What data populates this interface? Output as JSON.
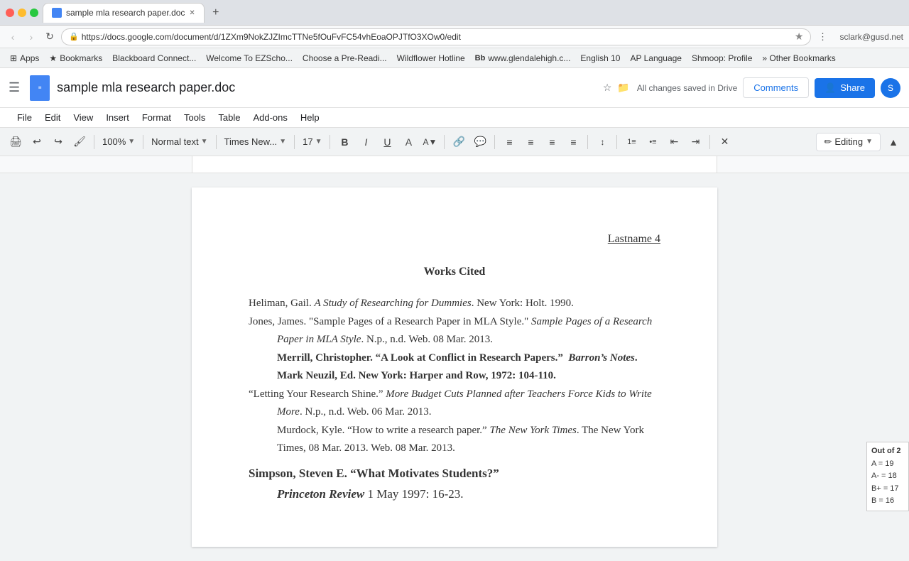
{
  "browser": {
    "tab_title": "sample mla research paper.doc",
    "url": "https://docs.google.com/document/d/1ZXm9NokZJZImcTTNe5fOuFvFC54vhEoaOPJTfO3XOw0/edit",
    "user_email": "sclark@gusd.net"
  },
  "bookmarks": [
    {
      "label": "Apps",
      "icon": "⊞"
    },
    {
      "label": "Bookmarks",
      "icon": "★"
    },
    {
      "label": "Blackboard Connect...",
      "icon": "📋"
    },
    {
      "label": "Welcome To EZScho...",
      "icon": "📄"
    },
    {
      "label": "Choose a Pre-Readi...",
      "icon": "🔖"
    },
    {
      "label": "Wildflower Hotline",
      "icon": "🌸"
    },
    {
      "label": "www.glendalehigh.c...",
      "icon": "Bb"
    },
    {
      "label": "English 10",
      "icon": "📚"
    },
    {
      "label": "AP Language",
      "icon": "📚"
    },
    {
      "label": "Shmoop: Profile",
      "icon": "📘"
    },
    {
      "label": "Other Bookmarks",
      "icon": "»"
    }
  ],
  "docs": {
    "title": "sample mla research paper.doc",
    "autosave": "All changes saved in Drive",
    "menu_items": [
      "File",
      "Edit",
      "View",
      "Insert",
      "Format",
      "Tools",
      "Table",
      "Add-ons",
      "Help"
    ],
    "toolbar": {
      "zoom": "100%",
      "style": "Normal text",
      "font": "Times New...",
      "size": "17",
      "editing_mode": "Editing"
    },
    "share_label": "Share",
    "comments_label": "Comments"
  },
  "document": {
    "page_number": "Lastname 4",
    "section_title": "Works Cited",
    "citations": [
      {
        "id": "citation-1",
        "text": "Heliman, Gail. ",
        "italic_part": "A Study of Researching for Dummies",
        "rest": ". New York: Holt. 1990.",
        "indent": false
      },
      {
        "id": "citation-2",
        "text_before": "Jones, James. \"Sample Pages of a Research Paper in MLA Style.\" ",
        "italic_part": "Sample Pages of a Research Paper in MLA Style",
        "rest": ". N.p., n.d. Web. 08 Mar. 2013.",
        "indent": false
      },
      {
        "id": "citation-3",
        "text_before": "Merrill, Christopher. “A Look at Conflict in Research Papers.”  ",
        "italic_part": "Barron’s Notes",
        "rest": ". Mark Neuzil, Ed. New York: Harper and Row, 1972: 104-110.",
        "indent": true
      },
      {
        "id": "citation-4",
        "text_before": "“Letting Your Research Shine.” ",
        "italic_part": "More Budget Cuts Planned after Teachers Force Kids to Write More",
        "rest": ". N.p., n.d. Web. 06 Mar. 2013.",
        "indent": false
      },
      {
        "id": "citation-5",
        "text_before": "Murdock, Kyle. “How to write a research paper.” ",
        "italic_part": "The New York Times",
        "rest": ". The New York Times, 08 Mar. 2013. Web. 08 Mar. 2013.",
        "indent": true
      },
      {
        "id": "citation-6",
        "bold_part": "Simpson, Steven E. “What Motivates Students?”",
        "rest": "",
        "indent": false,
        "is_bold": true
      },
      {
        "id": "citation-7",
        "italic_part": "Princeton Review",
        "rest": " 1 May 1997: 16-23.",
        "indent": true,
        "is_bold_italic": true
      }
    ]
  },
  "score_card": {
    "title": "Out of 2",
    "a19": "A = 19",
    "a18": "A- = 18",
    "b17": "B+ = 17",
    "b16": "B = 16"
  }
}
